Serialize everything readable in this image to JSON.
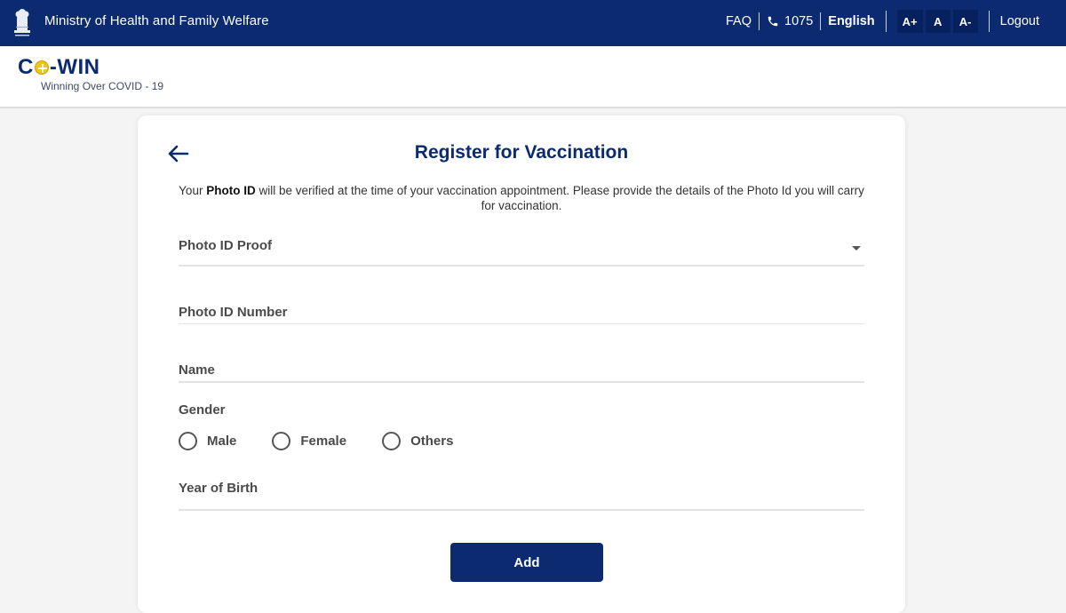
{
  "topbar": {
    "ministry": "Ministry of Health and Family Welfare",
    "faq": "FAQ",
    "helpline": "1075",
    "language": "English",
    "font_increase": "A+",
    "font_normal": "A",
    "font_decrease": "A-",
    "logout": "Logout",
    "icons": {
      "emblem": "national-emblem-icon",
      "phone": "phone-icon"
    }
  },
  "header": {
    "logo_prefix": "C",
    "logo_suffix": "-WIN",
    "tagline": "Winning Over COVID - 19"
  },
  "form": {
    "title": "Register for Vaccination",
    "back_icon": "arrow-left-icon",
    "note_prefix": "Your ",
    "note_bold": "Photo ID",
    "note_suffix": " will be verified at the time of your vaccination appointment. Please provide the details of the Photo Id you will carry for vaccination.",
    "photo_id_proof": {
      "label": "Photo ID Proof",
      "value": ""
    },
    "photo_id_number": {
      "label": "Photo ID Number",
      "value": ""
    },
    "name": {
      "label": "Name",
      "value": ""
    },
    "gender": {
      "label": "Gender",
      "options": [
        "Male",
        "Female",
        "Others"
      ],
      "selected": null
    },
    "year_of_birth": {
      "label": "Year of Birth",
      "value": ""
    },
    "submit_label": "Add"
  },
  "colors": {
    "brand_navy": "#0b2a6f",
    "logo_accent": "#f0c419",
    "page_bg": "#f4f4f4"
  }
}
